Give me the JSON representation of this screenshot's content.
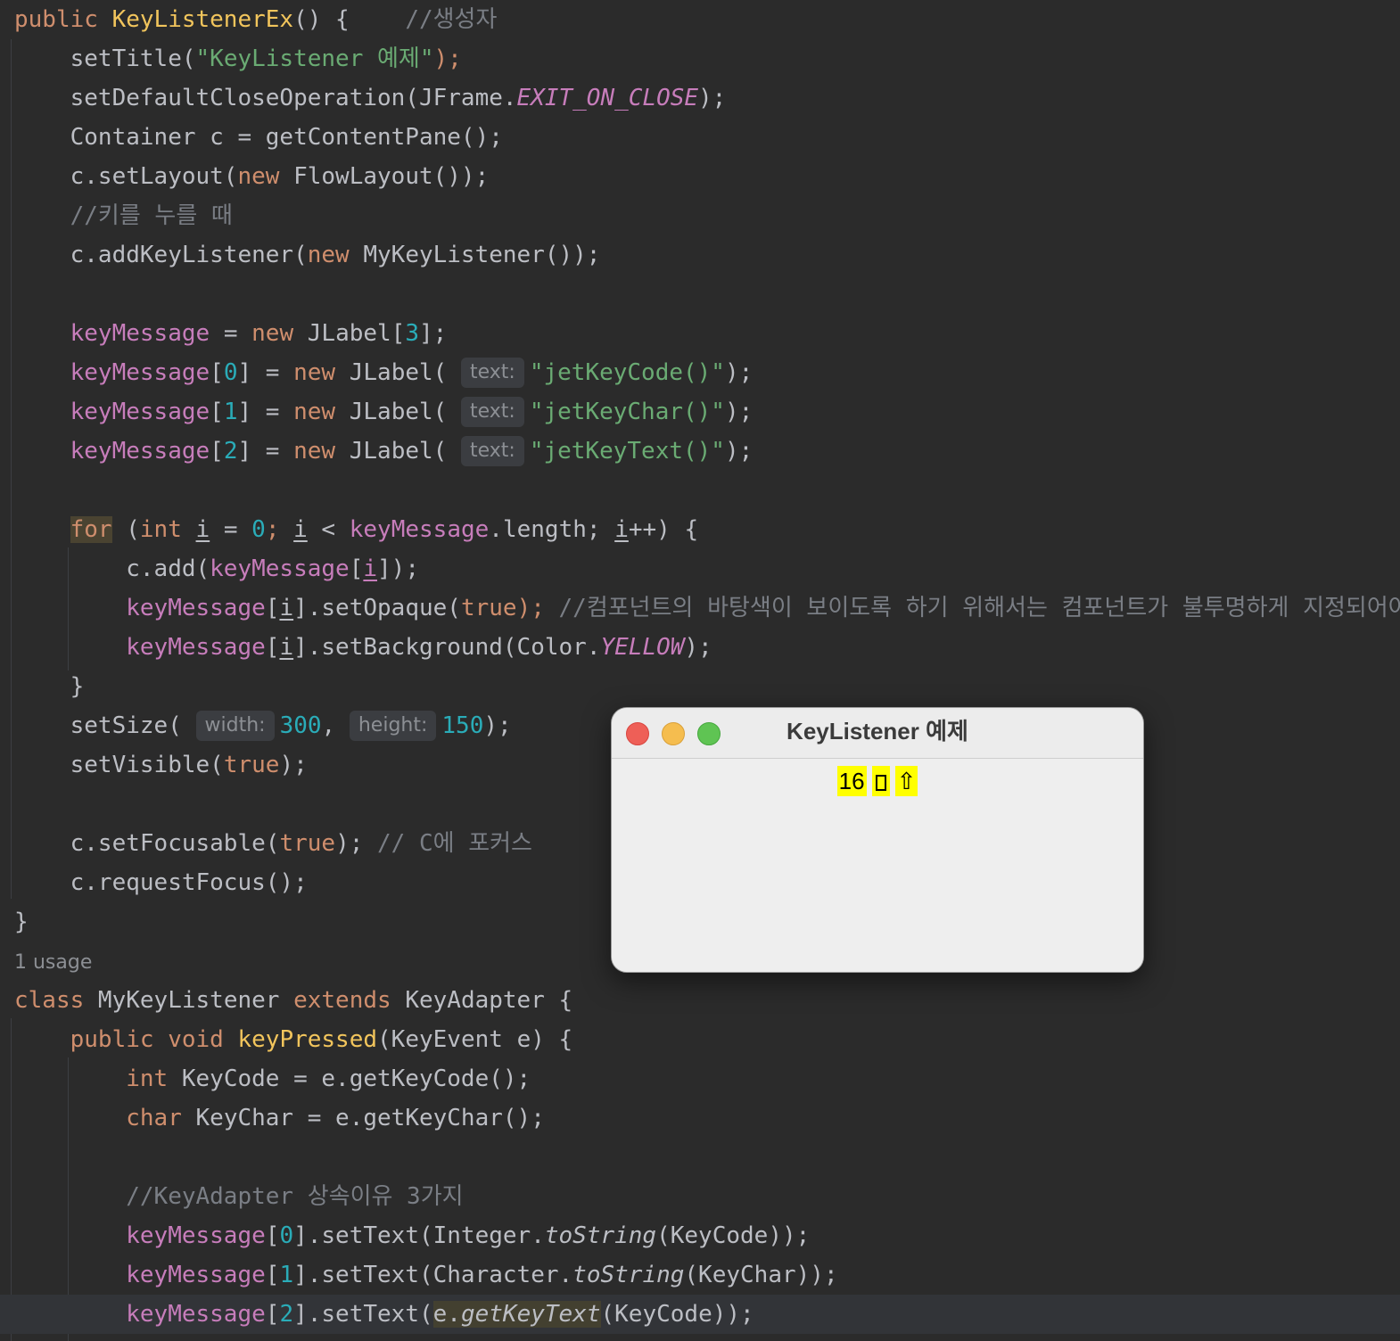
{
  "code": {
    "l1": {
      "a": "public ",
      "b": "KeyListenerEx",
      "c": "() {    ",
      "d": "//생성자"
    },
    "l2": {
      "a": "setTitle(",
      "b": "\"KeyListener 예제\"",
      "c": ");"
    },
    "l3": {
      "a": "setDefaultCloseOperation(JFrame.",
      "b": "EXIT_ON_CLOSE",
      "c": ");"
    },
    "l4": {
      "a": "Container c = getContentPane();"
    },
    "l5": {
      "a": "c.setLayout(",
      "b": "new",
      "c": " FlowLayout());"
    },
    "l6": {
      "a": "//키를 누를 때"
    },
    "l7": {
      "a": "c.addKeyListener(",
      "b": "new",
      "c": " MyKeyListener());"
    },
    "l8": {
      "a": "keyMessage",
      "b": " = ",
      "c": "new",
      "d": " JLabel[",
      "e": "3",
      "f": "];"
    },
    "l9": {
      "a": "keyMessage",
      "b": "[",
      "c": "0",
      "d": "] = ",
      "e": "new",
      "f": " JLabel( ",
      "hint": "text:",
      "g": "\"jetKeyCode()\"",
      "h": ");"
    },
    "l10": {
      "a": "keyMessage",
      "b": "[",
      "c": "1",
      "d": "] = ",
      "e": "new",
      "f": " JLabel( ",
      "hint": "text:",
      "g": "\"jetKeyChar()\"",
      "h": ");"
    },
    "l11": {
      "a": "keyMessage",
      "b": "[",
      "c": "2",
      "d": "] = ",
      "e": "new",
      "f": " JLabel( ",
      "hint": "text:",
      "g": "\"jetKeyText()\"",
      "h": ");"
    },
    "l12": {
      "a": "for",
      "b": " (",
      "c": "int",
      "d": " ",
      "e": "i",
      "f": " = ",
      "g": "0",
      "h": "; ",
      "i": "i",
      "j": " < ",
      "k": "keyMessage",
      "l": ".length; ",
      "m": "i",
      "n": "++) {"
    },
    "l13": {
      "a": "c.add(",
      "b": "keyMessage",
      "c": "[",
      "d": "i",
      "e": "]);"
    },
    "l14": {
      "a": "keyMessage",
      "b": "[",
      "c": "i",
      "d": "].setOpaque(",
      "e": "true",
      "f": "); ",
      "g": "//컴포넌트의 바탕색이 보이도록 하기 위해서는 컴포넌트가 불투명하게 지정되어야함."
    },
    "l15": {
      "a": "keyMessage",
      "b": "[",
      "c": "i",
      "d": "].setBackground(Color.",
      "e": "YELLOW",
      "f": ");"
    },
    "l16": {
      "a": "}"
    },
    "l17": {
      "a": "setSize( ",
      "hint1": "width:",
      "b": "300",
      "c": ", ",
      "hint2": "height:",
      "d": "150",
      "e": ");"
    },
    "l18": {
      "a": "setVisible(",
      "b": "true",
      "c": ");"
    },
    "l19": {
      "a": "c.setFocusable(",
      "b": "true",
      "c": "); ",
      "d": "// C에 포커스"
    },
    "l20": {
      "a": "c.requestFocus();"
    },
    "l21": {
      "a": "}"
    },
    "usage": "1 usage",
    "l22": {
      "a": "class",
      "b": " MyKeyListener ",
      "c": "extends",
      "d": " KeyAdapter {"
    },
    "l23": {
      "a": "public",
      "b": " ",
      "c": "void",
      "d": " ",
      "e": "keyPressed",
      "f": "(KeyEvent e) {"
    },
    "l24": {
      "a": "int",
      "b": " KeyCode = e.getKeyCode();"
    },
    "l25": {
      "a": "char",
      "b": " KeyChar = e.getKeyChar();"
    },
    "l26": {
      "a": "//KeyAdapter 상속이유 3가지"
    },
    "l27": {
      "a": "keyMessage",
      "b": "[",
      "c": "0",
      "d": "].setText(Integer.",
      "e": "toString",
      "f": "(KeyCode));"
    },
    "l28": {
      "a": "keyMessage",
      "b": "[",
      "c": "1",
      "d": "].setText(Character.",
      "e": "toString",
      "f": "(KeyChar));"
    },
    "l29": {
      "a": "keyMessage",
      "b": "[",
      "c": "2",
      "d": "].setText(",
      "e": "e.",
      "f": "getKeyText",
      "g": "(KeyCode));"
    }
  },
  "window": {
    "title": "KeyListener 예제",
    "labels": [
      "16",
      "⇧"
    ]
  },
  "colors": {
    "background": "#2b2b2b",
    "keyword": "#cf8e6d",
    "field": "#c77dbb",
    "string": "#6aab73",
    "number": "#2aacb8",
    "comment": "#7a7e85",
    "label_bg": "#ffff00"
  }
}
